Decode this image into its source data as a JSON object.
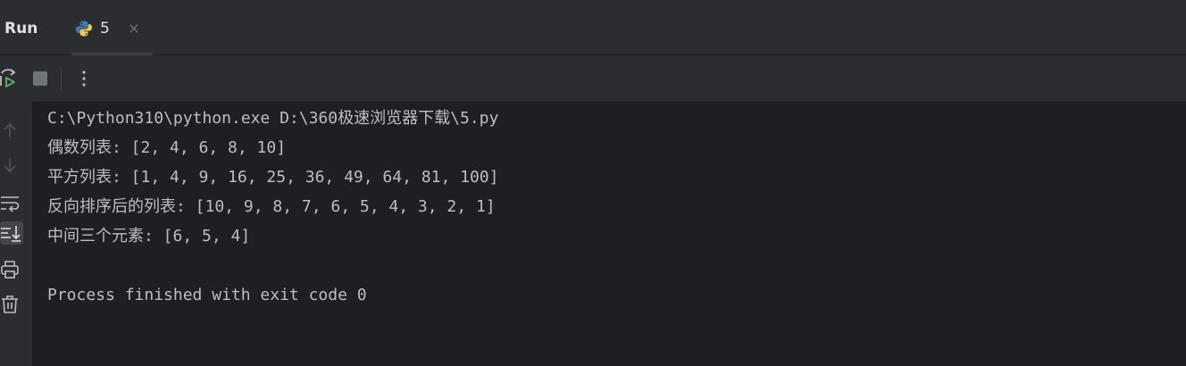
{
  "header": {
    "title": "Run",
    "tab": {
      "label": "5",
      "close_glyph": "×",
      "icon": "python-icon"
    }
  },
  "toolbar": {
    "buttons": [
      {
        "name": "rerun-icon"
      },
      {
        "name": "stop-icon"
      },
      {
        "name": "more-options-icon"
      }
    ]
  },
  "gutter": {
    "buttons": [
      {
        "name": "scroll-up-icon"
      },
      {
        "name": "scroll-down-icon"
      },
      {
        "name": "soft-wrap-icon"
      },
      {
        "name": "scroll-to-end-icon",
        "active": true
      },
      {
        "name": "print-icon"
      },
      {
        "name": "clear-all-icon"
      }
    ]
  },
  "console": {
    "lines": [
      "C:\\Python310\\python.exe D:\\360极速浏览器下载\\5.py",
      "偶数列表: [2, 4, 6, 8, 10]",
      "平方列表: [1, 4, 9, 16, 25, 36, 49, 64, 81, 100]",
      "反向排序后的列表: [10, 9, 8, 7, 6, 5, 4, 3, 2, 1]",
      "中间三个元素: [6, 5, 4]",
      "",
      "Process finished with exit code 0"
    ]
  },
  "colors": {
    "background": "#1e1f22",
    "panel": "#2b2d30",
    "text": "#bcbec4",
    "icon_gray": "#6f737a",
    "rerun_green": "#5fb865",
    "python_blue": "#3d7bbf",
    "python_yellow": "#f2c94c"
  }
}
